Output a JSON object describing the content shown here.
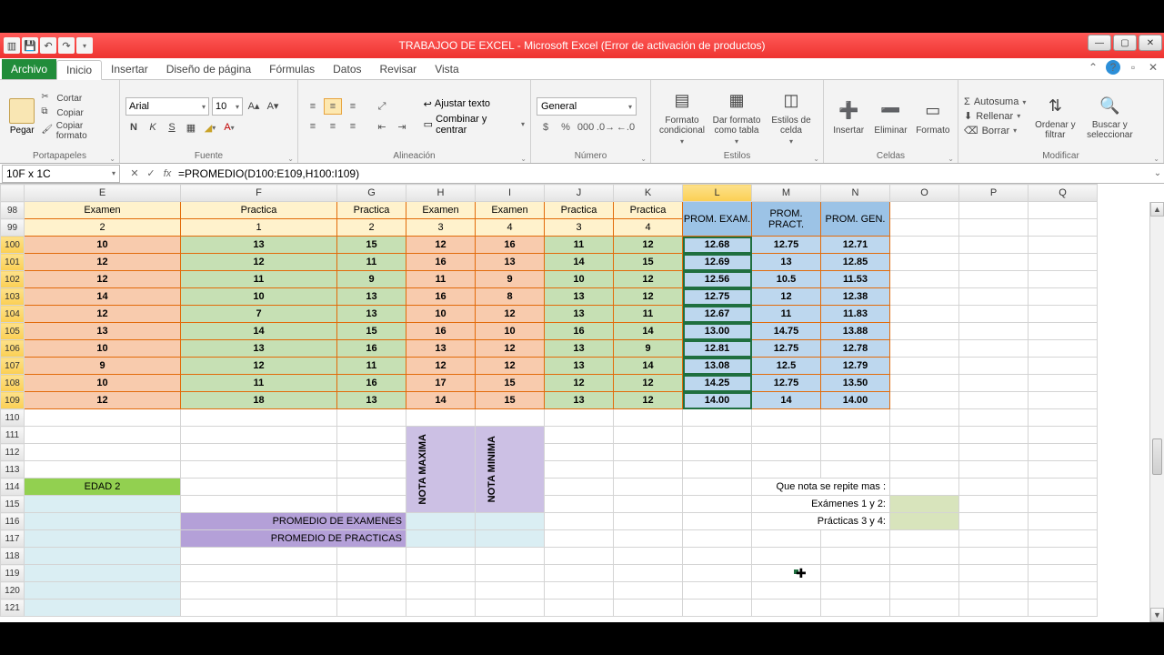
{
  "title": "TRABAJOO DE EXCEL - Microsoft Excel (Error de activación de productos)",
  "tabs": {
    "file": "Archivo",
    "items": [
      "Inicio",
      "Insertar",
      "Diseño de página",
      "Fórmulas",
      "Datos",
      "Revisar",
      "Vista"
    ],
    "active": "Inicio"
  },
  "ribbon": {
    "clipboard": {
      "paste": "Pegar",
      "cut": "Cortar",
      "copy": "Copiar",
      "formatpainter": "Copiar formato",
      "group": "Portapapeles"
    },
    "font": {
      "name": "Arial",
      "size": "10",
      "group": "Fuente"
    },
    "alignment": {
      "wrap": "Ajustar texto",
      "merge": "Combinar y centrar",
      "group": "Alineación"
    },
    "number": {
      "format": "General",
      "group": "Número"
    },
    "styles": {
      "condfmt": "Formato condicional",
      "astable": "Dar formato como tabla",
      "cellstyles": "Estilos de celda",
      "group": "Estilos"
    },
    "cells": {
      "insert": "Insertar",
      "delete": "Eliminar",
      "format": "Formato",
      "group": "Celdas"
    },
    "editing": {
      "autosum": "Autosuma",
      "fill": "Rellenar",
      "clear": "Borrar",
      "sort": "Ordenar y filtrar",
      "find": "Buscar y seleccionar",
      "group": "Modificar"
    }
  },
  "namebox": "10F x 1C",
  "formula": "=PROMEDIO(D100:E109,H100:I109)",
  "cols": [
    "E",
    "F",
    "G",
    "H",
    "I",
    "J",
    "K",
    "L",
    "M",
    "N",
    "O",
    "P",
    "Q"
  ],
  "row98": [
    "Examen",
    "Practica",
    "Practica",
    "Examen",
    "Examen",
    "Practica",
    "Practica",
    "PROM. EXAM.",
    "PROM. PRACT.",
    "PROM. GEN."
  ],
  "row99": [
    "2",
    "1",
    "2",
    "3",
    "4",
    "3",
    "4"
  ],
  "rows": [
    {
      "n": "100",
      "d": [
        "10",
        "13",
        "15",
        "12",
        "16",
        "11",
        "12",
        "12.68",
        "12.75",
        "12.71"
      ]
    },
    {
      "n": "101",
      "d": [
        "12",
        "12",
        "11",
        "16",
        "13",
        "14",
        "15",
        "12.69",
        "13",
        "12.85"
      ]
    },
    {
      "n": "102",
      "d": [
        "12",
        "11",
        "9",
        "11",
        "9",
        "10",
        "12",
        "12.56",
        "10.5",
        "11.53"
      ]
    },
    {
      "n": "103",
      "d": [
        "14",
        "10",
        "13",
        "16",
        "8",
        "13",
        "12",
        "12.75",
        "12",
        "12.38"
      ]
    },
    {
      "n": "104",
      "d": [
        "12",
        "7",
        "13",
        "10",
        "12",
        "13",
        "11",
        "12.67",
        "11",
        "11.83"
      ]
    },
    {
      "n": "105",
      "d": [
        "13",
        "14",
        "15",
        "16",
        "10",
        "16",
        "14",
        "13.00",
        "14.75",
        "13.88"
      ]
    },
    {
      "n": "106",
      "d": [
        "10",
        "13",
        "16",
        "13",
        "12",
        "13",
        "9",
        "12.81",
        "12.75",
        "12.78"
      ]
    },
    {
      "n": "107",
      "d": [
        "9",
        "12",
        "11",
        "12",
        "12",
        "13",
        "14",
        "13.08",
        "12.5",
        "12.79"
      ]
    },
    {
      "n": "108",
      "d": [
        "10",
        "11",
        "16",
        "17",
        "15",
        "12",
        "12",
        "14.25",
        "12.75",
        "13.50"
      ]
    },
    {
      "n": "109",
      "d": [
        "12",
        "18",
        "13",
        "14",
        "15",
        "13",
        "12",
        "14.00",
        "14",
        "14.00"
      ]
    }
  ],
  "labels": {
    "edad2": "EDAD 2",
    "notamax": "NOTA MAXIMA",
    "notamin": "NOTA MINIMA",
    "promex": "PROMEDIO DE EXAMENES",
    "prompr": "PROMEDIO DE PRACTICAS",
    "repite": "Que nota se repite mas :",
    "ex12": "Exámenes 1 y 2:",
    "pr34": "Prácticas 3 y 4:"
  }
}
